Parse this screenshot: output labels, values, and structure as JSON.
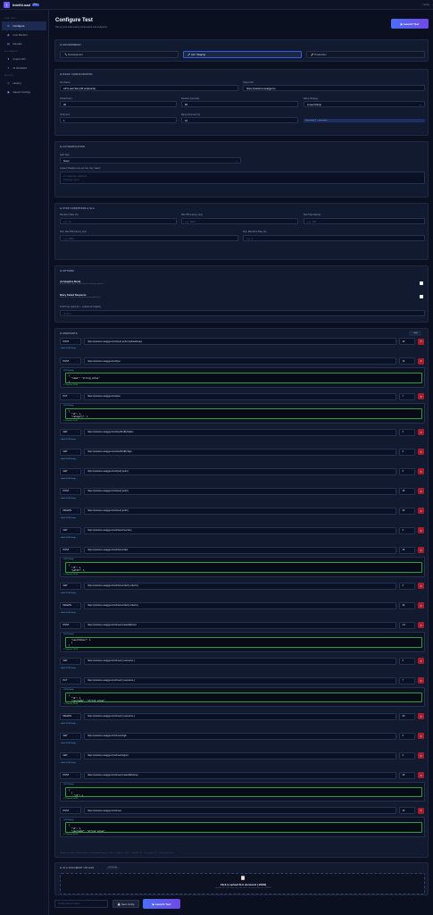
{
  "app": {
    "logo": "I",
    "name": "IntelliLoad",
    "badge": "Beta",
    "top_right": "< Guide"
  },
  "sidebar": {
    "groups": [
      {
        "label": "LOAD TEST",
        "items": [
          {
            "icon": "⚙",
            "label": "Configure",
            "active": true
          },
          {
            "icon": "◉",
            "label": "Live Monitor"
          },
          {
            "icon": "▤",
            "label": "Results"
          }
        ]
      },
      {
        "label": "DOCUMENTS",
        "items": [
          {
            "icon": "⬆",
            "label": "Import API"
          },
          {
            "icon": "✦",
            "label": "AI Assistant"
          }
        ]
      },
      {
        "label": "HISTORY",
        "items": [
          {
            "icon": "◷",
            "label": "History"
          },
          {
            "icon": "▣",
            "label": "Saved Configs"
          }
        ]
      }
    ]
  },
  "header": {
    "title": "Configure Test",
    "subtitle": "Set up your load testing parameters and endpoints",
    "launch_label": "▶ Launch Test"
  },
  "environment": {
    "title": "⚙ ENVIRONMENT",
    "options": [
      "🔧 Development",
      "🧪 QA / Staging",
      "🚀 Production"
    ],
    "active_index": 1
  },
  "basic": {
    "title": "⚙ BASIC CONFIGURATION",
    "test_name_label": "Test Name",
    "test_name_value": "API Load Test (30 endpoints)",
    "target_url_label": "Target URL",
    "target_url_value": "https://petstore.swagger.io",
    "virtual_users_label": "Virtual Users",
    "virtual_users_value": "30",
    "duration_label": "Duration (seconds)",
    "duration_value": "60",
    "ramp_label": "Ramp Strategy",
    "ramp_value": "Linear Ramp",
    "think_time_label": "Think time",
    "think_time_value": "1",
    "ramp_increment_label": "Ramp Increment (s)",
    "ramp_increment_value": "10",
    "ramp_chip": "Linear from 1 → max users"
  },
  "auth": {
    "title": "⚙ AUTHENTICATION",
    "auth_type_label": "Auth Type",
    "auth_type_value": "None",
    "headers_label": "Custom Headers (one per line: Key: Value)",
    "headers_placeholder_1": "# X-Api-Key: abc123",
    "headers_placeholder_2": "# Accept: json"
  },
  "stop": {
    "title": "⚙ STOP CONDITIONS & SLA",
    "fields": [
      {
        "label": "Max Error Rate (%)",
        "placeholder": "e.g. 10"
      },
      {
        "label": "Max P95 Latency (ms)",
        "placeholder": "e.g. 3000"
      },
      {
        "label": "Max Total Failures",
        "placeholder": "e.g. 100"
      },
      {
        "label": "SLA: Max P99 Latency (ms)",
        "placeholder": "e.g. 2000"
      },
      {
        "label": "SLA: Max Error Rate (%)",
        "placeholder": "e.g. 1"
      }
    ]
  },
  "options": {
    "title": "⚙ OPTIONS",
    "adaptive_title": "AI Adaptive Mode",
    "adaptive_desc": "Automatically adjust load based on response patterns",
    "retry_title": "Retry Failed Requests",
    "retry_desc": "Retry up to 2 times on connection errors/timeouts",
    "ai_key_label": "AI API Key (optional — enables AI insights)",
    "ai_key_placeholder": "sk-ant-..."
  },
  "endpoints": {
    "title": "⚙ ENDPOINTS",
    "add_label": "+ Add",
    "add_body": "+ Add JSON Body",
    "body_label": "JSON Body",
    "remove_body": "✕ Remove JSON",
    "rows": [
      {
        "method": "POST",
        "url": "https://petstore.swagger.io/v2/pet/{ petId }/uploadImage",
        "weight": "15"
      },
      {
        "method": "POST",
        "url": "https://petstore.swagger.io/v2/pet",
        "weight": "15",
        "body": "{\n  \"name\": \"string_value\"\n}"
      },
      {
        "method": "PUT",
        "url": "https://petstore.swagger.io/v2/pet",
        "weight": "7",
        "body": "{\n  \"id\": 1,\n  \"category\": {"
      },
      {
        "method": "GET",
        "url": "https://petstore.swagger.io/v2/pet/findByStatus",
        "weight": "3"
      },
      {
        "method": "GET",
        "url": "https://petstore.swagger.io/v2/pet/findByTags",
        "weight": "3"
      },
      {
        "method": "GET",
        "url": "https://petstore.swagger.io/v2/pet/{ petId }",
        "weight": "3"
      },
      {
        "method": "POST",
        "url": "https://petstore.swagger.io/v2/pet/{ petId }",
        "weight": "15"
      },
      {
        "method": "DELETE",
        "url": "https://petstore.swagger.io/v2/pet/{ petId }",
        "weight": "20"
      },
      {
        "method": "GET",
        "url": "https://petstore.swagger.io/v2/store/inventory",
        "weight": "3"
      },
      {
        "method": "POST",
        "url": "https://petstore.swagger.io/v2/store/order",
        "weight": "15",
        "body": "{\n  \"id\": 1,\n  \"petId\": 1,"
      },
      {
        "method": "GET",
        "url": "https://petstore.swagger.io/v2/store/order/{ orderId }",
        "weight": "3"
      },
      {
        "method": "DELETE",
        "url": "https://petstore.swagger.io/v2/store/order/{ orderId }",
        "weight": "20"
      },
      {
        "method": "POST",
        "url": "https://petstore.swagger.io/v2/user/createWithList",
        "weight": "1.0",
        "body": "  \"userStatus\": 1\n  }\n]"
      },
      {
        "method": "GET",
        "url": "https://petstore.swagger.io/v2/user/{ username }",
        "weight": "3"
      },
      {
        "method": "PUT",
        "url": "https://petstore.swagger.io/v2/user/{ username }",
        "weight": "7",
        "body": "{\n  \"id\": 1,\n  \"username\": \"string_value\","
      },
      {
        "method": "DELETE",
        "url": "https://petstore.swagger.io/v2/user/{ username }",
        "weight": "20"
      },
      {
        "method": "GET",
        "url": "https://petstore.swagger.io/v2/user/login",
        "weight": "3"
      },
      {
        "method": "GET",
        "url": "https://petstore.swagger.io/v2/user/logout",
        "weight": "3"
      },
      {
        "method": "POST",
        "url": "https://petstore.swagger.io/v2/user/createWithArray",
        "weight": "15",
        "body": "[\n  {\n    \"id\": 1,"
      },
      {
        "method": "POST",
        "url": "https://petstore.swagger.io/v2/user",
        "weight": "15",
        "body": "{\n  \"id\": 1,\n  \"username\": \"string_value\","
      }
    ],
    "footer": "Weights are relative. Higher weight = more frequent requests. GET: 3 · POST: 15 · PUT: 7 · DELETE: 20 · Total weight: 222 · Click weight to edit."
  },
  "sla_doc": {
    "title": "⚙ SLA DOCUMENT UPLOAD",
    "badge": "OPTIONAL",
    "icon": "📋",
    "upload_title": "Click to upload SLA document (.JSON)",
    "upload_sub": "Include P95, P99, error_rate, min_RPS, max_error_rate, etc. in JSON"
  },
  "bottom": {
    "config_placeholder": "Config name to save...",
    "save_label": "💾 Save Config",
    "launch_label": "▶ Launch Test"
  }
}
